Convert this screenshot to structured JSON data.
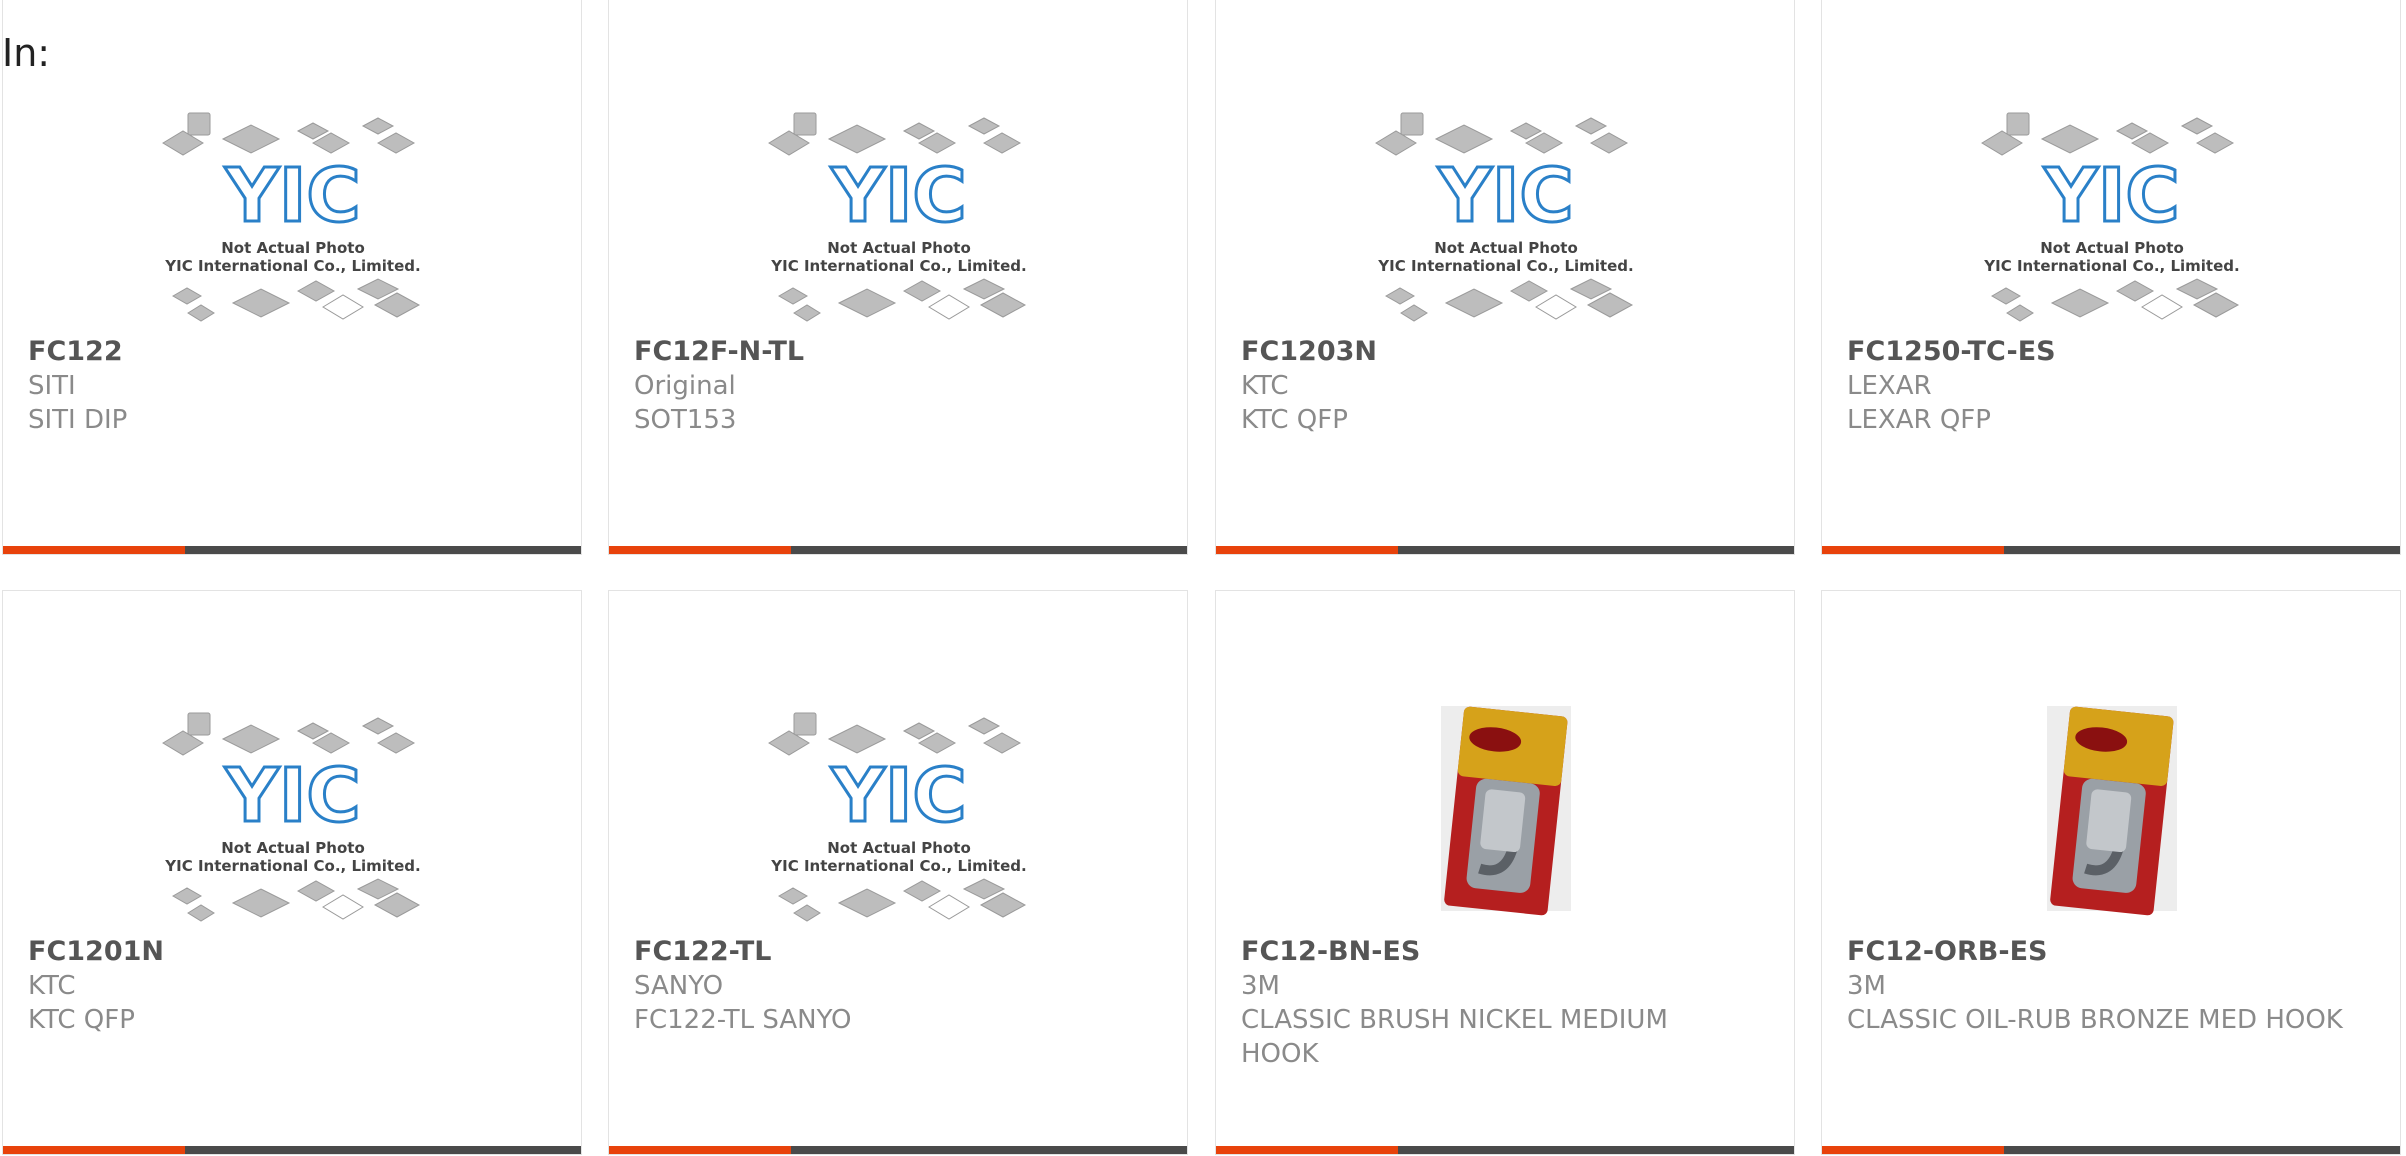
{
  "header": {
    "label": "In:"
  },
  "colors": {
    "accent": "#e8420b",
    "bar": "#4a4a4a",
    "yic_blue": "#2a80c8",
    "chip_gray": "#bdbdbd"
  },
  "placeholder": {
    "title": "Not Actual Photo",
    "company": "YIC International Co., Limited.",
    "logo": "YIC"
  },
  "products": [
    {
      "part": "FC122",
      "maker": "SITI",
      "desc": "SITI DIP",
      "image": "yic-placeholder"
    },
    {
      "part": "FC12F-N-TL",
      "maker": "Original",
      "desc": "SOT153",
      "image": "yic-placeholder"
    },
    {
      "part": "FC1203N",
      "maker": "KTC",
      "desc": "KTC QFP",
      "image": "yic-placeholder"
    },
    {
      "part": "FC1250-TC-ES",
      "maker": "LEXAR",
      "desc": "LEXAR QFP",
      "image": "yic-placeholder"
    },
    {
      "part": "FC1201N",
      "maker": "KTC",
      "desc": "KTC QFP",
      "image": "yic-placeholder"
    },
    {
      "part": "FC122-TL",
      "maker": "SANYO",
      "desc": "FC122-TL SANYO",
      "image": "yic-placeholder"
    },
    {
      "part": "FC12-BN-ES",
      "maker": "3M",
      "desc": "CLASSIC BRUSH NICKEL MEDIUM HOOK",
      "image": "command-hook-package"
    },
    {
      "part": "FC12-ORB-ES",
      "maker": "3M",
      "desc": "CLASSIC OIL-RUB BRONZE MED HOOK",
      "image": "command-hook-package"
    }
  ]
}
